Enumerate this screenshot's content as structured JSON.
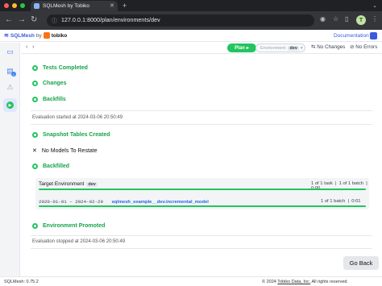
{
  "browser": {
    "tab_title": "SQLMesh by Tobiko",
    "url": "127.0.0.1:8000/plan/environments/dev",
    "profile_initial": "T"
  },
  "header": {
    "logo_text": "SQLMesh",
    "logo_by": "by",
    "tobiko": "tobiko",
    "docs_link": "Documentation"
  },
  "toolbar": {
    "plan_label": "Plan",
    "env_label": "Environment:",
    "env_value": "dev",
    "no_changes": "No Changes",
    "no_errors": "No Errors"
  },
  "plan": {
    "steps_top": [
      {
        "label": "Tests Completed"
      },
      {
        "label": "Changes"
      },
      {
        "label": "Backfills"
      }
    ],
    "eval_started": "Evaluation started at 2024-03-06 20:50:49",
    "snapshot_tables": "Snapshot Tables Created",
    "no_models": "No Models To Restate",
    "backfilled": "Backfilled",
    "target_env_label": "Target Environment",
    "target_env_value": "dev",
    "target_tasks": "1 of 1 task",
    "target_batches": "1 of 1 batch",
    "target_time": "0:00",
    "task_date_range": "2020-01-01 – 2024-02-29",
    "task_model": "sqlmesh_example__dev.incremental_model",
    "task_batches": "1 of 1 batch",
    "task_time": "0:01",
    "env_promoted": "Environment Promoted",
    "eval_stopped": "Evaluation stopped at 2024-03-06 20:50:49",
    "go_back": "Go Back"
  },
  "footer": {
    "version": "SQLMesh: 0.75.2",
    "copyright_prefix": "© 2024",
    "company": "Tobiko Data, Inc.",
    "rights": "All rights reserved."
  },
  "colors": {
    "success": "#22c55e",
    "accent": "#3b5bdb",
    "link": "#2563eb"
  }
}
